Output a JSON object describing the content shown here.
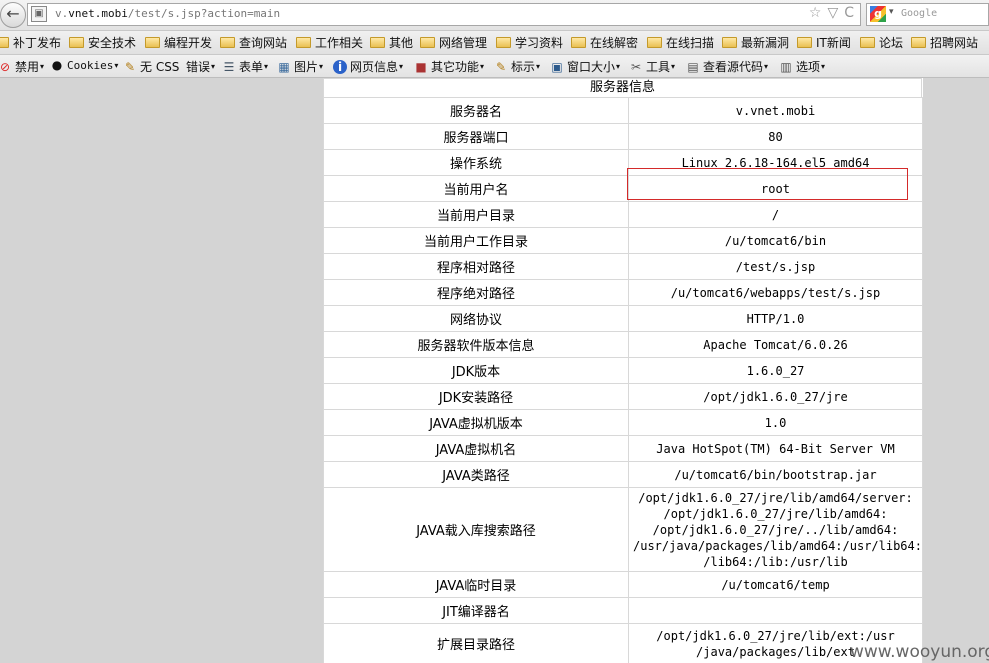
{
  "browser": {
    "url_prefix": "v.",
    "url_domain": "vnet.mobi",
    "url_path": "/test/s.jsp?action=main",
    "search_placeholder": "Google",
    "site_icon": "page-icon",
    "star_icon": "☆",
    "dropdown_icon": "▽",
    "reload_icon": "C"
  },
  "bookmarks": [
    "补丁发布",
    "安全技术",
    "编程开发",
    "查询网站",
    "工作相关",
    "其他",
    "网络管理",
    "学习资料",
    "在线解密",
    "在线扫描",
    "最新漏洞",
    "IT新闻",
    "论坛",
    "招聘网站"
  ],
  "toolbar": [
    "禁用",
    "Cookies",
    "无 CSS",
    "错误",
    "表单",
    "图片",
    "网页信息",
    "其它功能",
    "标示",
    "窗口大小",
    "工具",
    "查看源代码",
    "选项"
  ],
  "page": {
    "caption": "服务器信息",
    "rows": [
      {
        "label": "服务器名",
        "value": "v.vnet.mobi"
      },
      {
        "label": "服务器端口",
        "value": "80"
      },
      {
        "label": "操作系统",
        "value": "Linux 2.6.18-164.el5 amd64"
      },
      {
        "label": "当前用户名",
        "value": "root"
      },
      {
        "label": "当前用户目录",
        "value": "/"
      },
      {
        "label": "当前用户工作目录",
        "value": "/u/tomcat6/bin"
      },
      {
        "label": "程序相对路径",
        "value": "/test/s.jsp"
      },
      {
        "label": "程序绝对路径",
        "value": "/u/tomcat6/webapps/test/s.jsp"
      },
      {
        "label": "网络协议",
        "value": "HTTP/1.0"
      },
      {
        "label": "服务器软件版本信息",
        "value": "Apache Tomcat/6.0.26"
      },
      {
        "label": "JDK版本",
        "value": "1.6.0_27"
      },
      {
        "label": "JDK安装路径",
        "value": "/opt/jdk1.6.0_27/jre"
      },
      {
        "label": "JAVA虚拟机版本",
        "value": "1.0"
      },
      {
        "label": "JAVA虚拟机名",
        "value": "Java HotSpot(TM) 64-Bit Server VM"
      },
      {
        "label": "JAVA类路径",
        "value": "/u/tomcat6/bin/bootstrap.jar"
      },
      {
        "label": "JAVA载入库搜索路径",
        "value": "/opt/jdk1.6.0_27/jre/lib/amd64/server:\n/opt/jdk1.6.0_27/jre/lib/amd64:\n/opt/jdk1.6.0_27/jre/../lib/amd64:\n/usr/java/packages/lib/amd64:/usr/lib64:\n/lib64:/lib:/usr/lib"
      },
      {
        "label": "JAVA临时目录",
        "value": "/u/tomcat6/temp"
      },
      {
        "label": "JIT编译器名",
        "value": ""
      },
      {
        "label": "扩展目录路径",
        "value": "/opt/jdk1.6.0_27/jre/lib/ext:/usr\n/java/packages/lib/ext"
      }
    ]
  },
  "watermark": "www.wooyun.org",
  "highlight_color": "#d42a2a"
}
